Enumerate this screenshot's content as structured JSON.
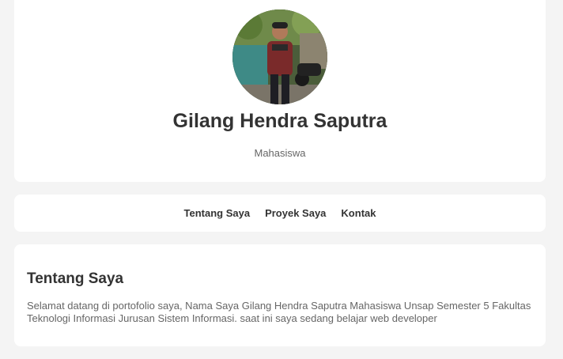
{
  "profile": {
    "name": "Gilang Hendra Saputra",
    "role": "Mahasiswa",
    "avatar_icon": "profile-photo"
  },
  "nav": {
    "items": [
      {
        "label": "Tentang Saya"
      },
      {
        "label": "Proyek Saya"
      },
      {
        "label": "Kontak"
      }
    ]
  },
  "about": {
    "title": "Tentang Saya",
    "text": "Selamat datang di portofolio saya, Nama Saya Gilang Hendra Saputra Mahasiswa Unsap Semester 5 Fakultas Teknologi Informasi Jurusan Sistem Informasi. saat ini saya sedang belajar web developer"
  },
  "colors": {
    "background": "#f4f4f4",
    "card": "#ffffff",
    "heading": "#333333",
    "muted": "#666666"
  }
}
